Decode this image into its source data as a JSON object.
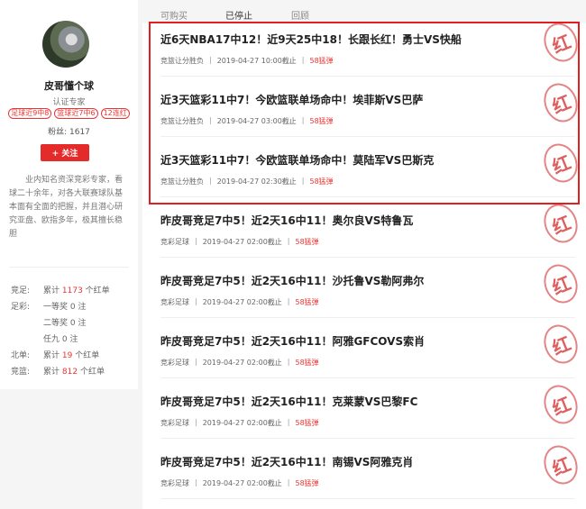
{
  "tabs": [
    "可购买",
    "已停止",
    "回顾"
  ],
  "active_tab": 1,
  "profile": {
    "name": "皮哥懂个球",
    "cert": "认证专家",
    "badges": [
      "足球近9中8",
      "篮球近7中6",
      "12连红"
    ],
    "fans_label": "粉丝:",
    "fans": "1617",
    "follow_label": "+ 关注",
    "bio": "业内知名资深竞彩专家，看球二十余年，对各大联赛球队基本面有全面的把握，并且潜心研究亚盘、欧指多年，极其擅长稳胆"
  },
  "stats": [
    {
      "label": "竞足:",
      "text1": "累计",
      "value": "1173",
      "text2": "个红单"
    },
    {
      "label": "足彩:",
      "text1": "一等奖",
      "value": "0",
      "text2": "注",
      "plain": true
    },
    {
      "label": "",
      "text1": "二等奖",
      "value": "0",
      "text2": "注",
      "plain": true
    },
    {
      "label": "",
      "text1": "任九",
      "value": "0",
      "text2": "注",
      "plain": true
    },
    {
      "label": "北单:",
      "text1": "累计",
      "value": "19",
      "text2": "个红单"
    },
    {
      "label": "竞篮:",
      "text1": "累计",
      "value": "812",
      "text2": "个红单"
    }
  ],
  "stamp_char": "红",
  "articles": [
    {
      "title": "近6天NBA17中12！近9天25中18！长跟长红！勇士VS快船",
      "category": "竞篮让分胜负",
      "time": "2019-04-27 10:00截止",
      "price": "58猛弹"
    },
    {
      "title": "近3天篮彩11中7！今欧篮联单场命中！埃菲斯VS巴萨",
      "category": "竞篮让分胜负",
      "time": "2019-04-27 03:00截止",
      "price": "58猛弹"
    },
    {
      "title": "近3天篮彩11中7！今欧篮联单场命中！莫陆军VS巴斯克",
      "category": "竞篮让分胜负",
      "time": "2019-04-27 02:30截止",
      "price": "58猛弹"
    },
    {
      "title": "昨皮哥竞足7中5！近2天16中11！奥尔良VS特鲁瓦",
      "category": "竞彩足球",
      "time": "2019-04-27 02:00截止",
      "price": "58猛弹"
    },
    {
      "title": "昨皮哥竞足7中5！近2天16中11！沙托鲁VS勒阿弗尔",
      "category": "竞彩足球",
      "time": "2019-04-27 02:00截止",
      "price": "58猛弹"
    },
    {
      "title": "昨皮哥竞足7中5！近2天16中11！阿雅GFCOVS索肖",
      "category": "竞彩足球",
      "time": "2019-04-27 02:00截止",
      "price": "58猛弹"
    },
    {
      "title": "昨皮哥竞足7中5！近2天16中11！克莱蒙VS巴黎FC",
      "category": "竞彩足球",
      "time": "2019-04-27 02:00截止",
      "price": "58猛弹"
    },
    {
      "title": "昨皮哥竞足7中5！近2天16中11！南锡VS阿雅克肖",
      "category": "竞彩足球",
      "time": "2019-04-27 02:00截止",
      "price": "58猛弹"
    }
  ]
}
